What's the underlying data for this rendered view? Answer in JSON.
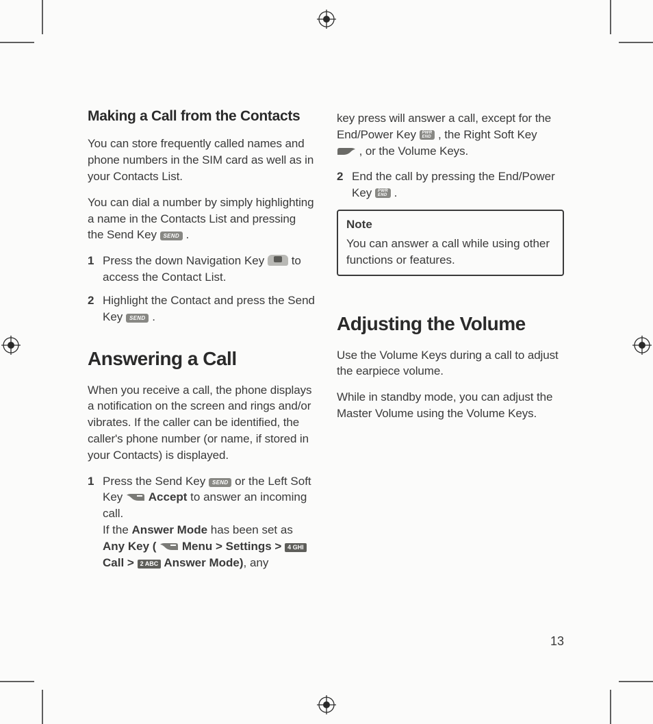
{
  "page_number": "13",
  "left": {
    "h_sub": "Making a Call from the Contacts",
    "p1": "You can store frequently called names and phone numbers in the SIM card as well as in your Contacts List.",
    "p2a": "You can dial a number by simply highlighting a name in the Contacts List and pressing the Send Key ",
    "p2b": " .",
    "li1_n": "1",
    "li1a": "Press the down Navigation Key ",
    "li1b": " to access the Contact List.",
    "li2_n": "2",
    "li2a": "Highlight the Contact and press the Send Key ",
    "li2b": " .",
    "h_main": "Answering a Call",
    "p3": "When you receive a call, the phone displays a notification on the screen and rings and/or vibrates. If the caller can be identified, the caller's phone number (or name, if stored in your Contacts) is displayed.",
    "li3_n": "1",
    "li3a": "Press the Send Key ",
    "li3b": " or the Left Soft Key ",
    "li3c_bold": "Accept",
    "li3d": " to answer an incoming call.",
    "li3e": "If the ",
    "li3f_bold": "Answer Mode",
    "li3g": " has been set as ",
    "li3h_bold": "Any Key (",
    "li3i_bold": " Menu > Settings > ",
    "li3j_bold": " Call > ",
    "li3k_bold": " Answer Mode)",
    "li3l": ", any"
  },
  "right": {
    "p1a": "key press will answer a call, except for the End/Power Key ",
    "p1b": " , the Right Soft Key ",
    "p1c": " , or the Volume Keys.",
    "li2_n": "2",
    "li2a": "End the call by pressing the End/Power Key ",
    "li2b": " .",
    "note_title": "Note",
    "note_body": "You can answer a call while using other functions or features.",
    "h_main": "Adjusting the Volume",
    "p2": "Use the Volume Keys during a call to adjust the earpiece volume.",
    "p3": "While in standby mode, you can adjust the Master Volume using the Volume Keys."
  },
  "icons": {
    "send": "SEND",
    "end_l1": "PWR",
    "end_l2": "END",
    "key4": "4 GHI",
    "key2": "2 ABC"
  }
}
